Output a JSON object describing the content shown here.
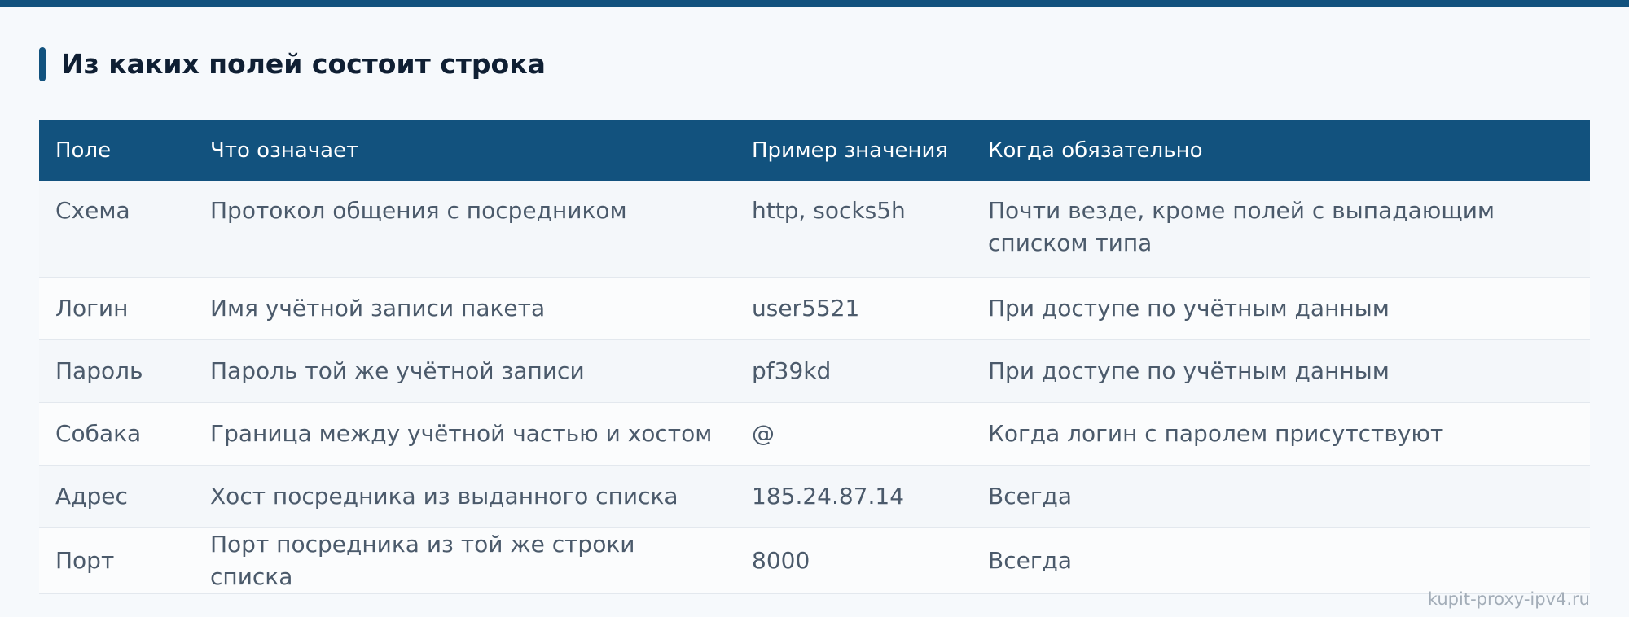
{
  "heading": "Из каких полей состоит строка",
  "table": {
    "headers": [
      "Поле",
      "Что означает",
      "Пример значения",
      "Когда обязательно"
    ],
    "rows": [
      [
        "Схема",
        "Протокол общения с посредником",
        "http, socks5h",
        "Почти везде, кроме полей с выпадающим списком типа"
      ],
      [
        "Логин",
        "Имя учётной записи пакета",
        "user5521",
        "При доступе по учётным данным"
      ],
      [
        "Пароль",
        "Пароль той же учётной записи",
        "pf39kd",
        "При доступе по учётным данным"
      ],
      [
        "Собака",
        "Граница между учётной частью и хостом",
        "@",
        "Когда логин с паролем присутствуют"
      ],
      [
        "Адрес",
        "Хост посредника из выданного списка",
        "185.24.87.14",
        "Всегда"
      ],
      [
        "Порт",
        "Порт посредника из той же строки списка",
        "8000",
        "Всегда"
      ]
    ]
  },
  "watermark": "kupit-proxy-ipv4.ru",
  "colors": {
    "accent": "#12527e",
    "background": "#f6f9fc",
    "heading_text": "#0f1f33",
    "body_text": "#4b5a6b"
  }
}
